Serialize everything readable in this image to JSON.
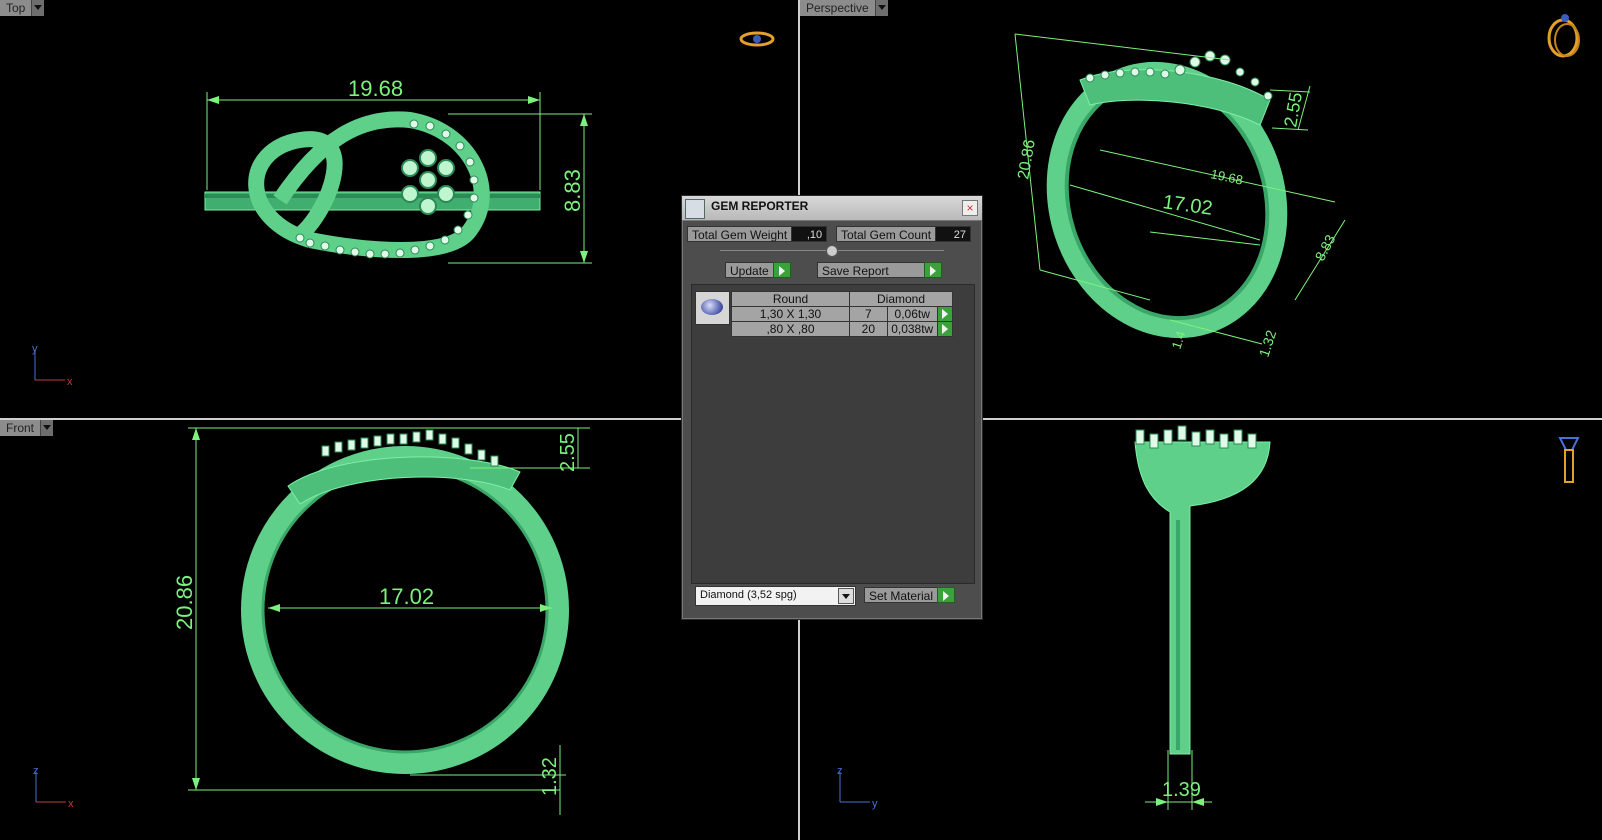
{
  "viewports": {
    "top": {
      "label": "Top",
      "axis_v": "y",
      "axis_h": "x",
      "dims": {
        "width": "19.68",
        "height": "8.83"
      }
    },
    "perspective": {
      "label": "Perspective",
      "dims": {
        "height": "20.86",
        "head": "2.55",
        "width": "19.68",
        "inner": "17.02",
        "depth": "8.83",
        "base1": "1.4",
        "base2": "1.32"
      }
    },
    "front": {
      "label": "Front",
      "axis_v": "z",
      "axis_h": "x",
      "dims": {
        "height": "20.86",
        "head": "2.55",
        "inner": "17.02",
        "base": "1.32"
      }
    },
    "right": {
      "axis_v": "z",
      "axis_h": "y",
      "dims": {
        "shank": "1.39"
      }
    }
  },
  "gem_reporter": {
    "title": "GEM REPORTER",
    "total_weight_label": "Total Gem Weight",
    "total_weight_value": ",10",
    "total_count_label": "Total Gem Count",
    "total_count_value": "27",
    "update_label": "Update",
    "save_label": "Save Report",
    "table": {
      "header_shape": "Round",
      "header_material": "Diamond",
      "rows": [
        {
          "size": "1,30 X 1,30",
          "count": "7",
          "weight": "0,06tw"
        },
        {
          "size": ",80 X ,80",
          "count": "20",
          "weight": "0,038tw"
        }
      ]
    },
    "material_select": "Diamond      (3,52 spg)",
    "set_material_label": "Set Material"
  },
  "colors": {
    "model": "#5fd08a",
    "dimension": "#7df17d",
    "background": "#000000"
  }
}
